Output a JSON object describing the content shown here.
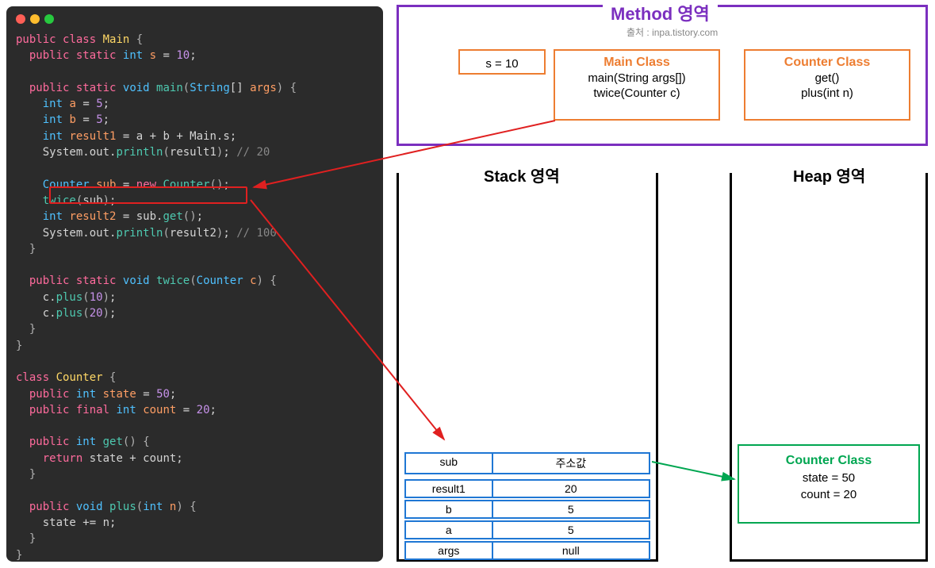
{
  "method_area": {
    "title": "Method 영역",
    "source": "출처 : inpa.tistory.com",
    "s_box": "s = 10",
    "main_class": {
      "title": "Main Class",
      "line1": "main(String args[])",
      "line2": "twice(Counter c)"
    },
    "counter_class": {
      "title": "Counter Class",
      "line1": "get()",
      "line2": "plus(int n)"
    }
  },
  "stack_area": {
    "title": "Stack 영역",
    "rows": [
      {
        "name": "sub",
        "value": "주소값"
      },
      {
        "name": "result1",
        "value": "20"
      },
      {
        "name": "b",
        "value": "5"
      },
      {
        "name": "a",
        "value": "5"
      },
      {
        "name": "args",
        "value": "null"
      }
    ]
  },
  "heap_area": {
    "title": "Heap 영역",
    "box": {
      "title": "Counter Class",
      "line1": "state = 50",
      "line2": "count = 20"
    }
  },
  "code": {
    "lines": [
      "public class Main {",
      "  public static int s = 10;",
      "",
      "  public static void main(String[] args) {",
      "    int a = 5;",
      "    int b = 5;",
      "    int result1 = a + b + Main.s;",
      "    System.out.println(result1); // 20",
      "",
      "    Counter sub = new Counter();",
      "    twice(sub);",
      "    int result2 = sub.get();",
      "    System.out.println(result2); // 100",
      "  }",
      "",
      "  public static void twice(Counter c) {",
      "    c.plus(10);",
      "    c.plus(20);",
      "  }",
      "}",
      "",
      "class Counter {",
      "  public int state = 50;",
      "  public final int count = 20;",
      "",
      "  public int get() {",
      "    return state + count;",
      "  }",
      "",
      "  public void plus(int n) {",
      "    state += n;",
      "  }",
      "}"
    ]
  }
}
